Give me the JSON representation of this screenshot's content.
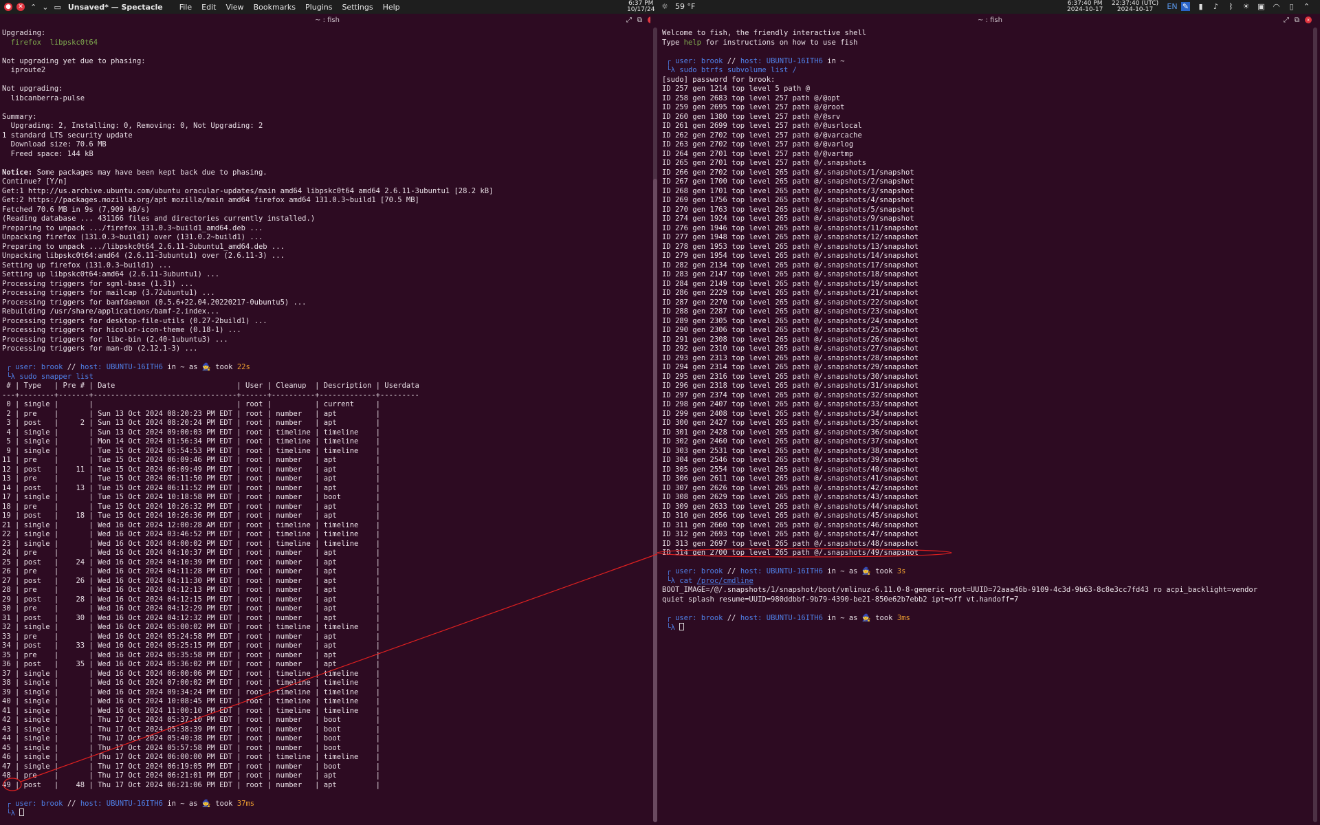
{
  "topbar": {
    "app_title": "Unsaved* — Spectacle",
    "menus": [
      "File",
      "Edit",
      "View",
      "Bookmarks",
      "Plugins",
      "Settings",
      "Help"
    ],
    "clock1_time": "6:37 PM",
    "clock1_date": "10/17/24",
    "weather": "59 °F",
    "clock2_time": "6:37:40 PM",
    "clock2_date": "2024-10-17",
    "clock3_time": "22:37:40 (UTC)",
    "clock3_date": "2024-10-17",
    "lang": "EN"
  },
  "left": {
    "title": "~ : fish",
    "lines": [
      "Upgrading:",
      "  firefox  libpskc0t64",
      "",
      "Not upgrading yet due to phasing:",
      "  iproute2",
      "",
      "Not upgrading:",
      "  libcanberra-pulse",
      "",
      "Summary:",
      "  Upgrading: 2, Installing: 0, Removing: 0, Not Upgrading: 2",
      "1 standard LTS security update",
      "  Download size: 70.6 MB",
      "  Freed space: 144 kB",
      "",
      "Notice: Some packages may have been kept back due to phasing.",
      "Continue? [Y/n]",
      "Get:1 http://us.archive.ubuntu.com/ubuntu oracular-updates/main amd64 libpskc0t64 amd64 2.6.11-3ubuntu1 [28.2 kB]",
      "Get:2 https://packages.mozilla.org/apt mozilla/main amd64 firefox amd64 131.0.3~build1 [70.5 MB]",
      "Fetched 70.6 MB in 9s (7,909 kB/s)",
      "(Reading database ... 431166 files and directories currently installed.)",
      "Preparing to unpack .../firefox_131.0.3~build1_amd64.deb ...",
      "Unpacking firefox (131.0.3~build1) over (131.0.2~build1) ...",
      "Preparing to unpack .../libpskc0t64_2.6.11-3ubuntu1_amd64.deb ...",
      "Unpacking libpskc0t64:amd64 (2.6.11-3ubuntu1) over (2.6.11-3) ...",
      "Setting up firefox (131.0.3~build1) ...",
      "Setting up libpskc0t64:amd64 (2.6.11-3ubuntu1) ...",
      "Processing triggers for sgml-base (1.31) ...",
      "Processing triggers for mailcap (3.72ubuntu1) ...",
      "Processing triggers for bamfdaemon (0.5.6+22.04.20220217-0ubuntu5) ...",
      "Rebuilding /usr/share/applications/bamf-2.index...",
      "Processing triggers for desktop-file-utils (0.27-2build1) ...",
      "Processing triggers for hicolor-icon-theme (0.18-1) ...",
      "Processing triggers for libc-bin (2.40-1ubuntu3) ...",
      "Processing triggers for man-db (2.12.1-3) ...",
      ""
    ],
    "prompt1": {
      "user": "user: brook",
      "sep": " // ",
      "host": "host: UBUNTU-16ITH6",
      "tail": " in ~ as 🧙 took ",
      "took": "22s"
    },
    "cmd1": "sudo snapper list",
    "table_header": " # | Type   | Pre # | Date                            | User | Cleanup  | Description | Userdata",
    "table_rule": "---+--------+-------+---------------------------------+------+----------+-------------+---------",
    "table_rows": [
      " 0 | single |       |                                 | root |          | current     |",
      " 2 | pre    |       | Sun 13 Oct 2024 08:20:23 PM EDT | root | number   | apt         |",
      " 3 | post   |     2 | Sun 13 Oct 2024 08:20:24 PM EDT | root | number   | apt         |",
      " 4 | single |       | Sun 13 Oct 2024 09:00:03 PM EDT | root | timeline | timeline    |",
      " 5 | single |       | Mon 14 Oct 2024 01:56:34 PM EDT | root | timeline | timeline    |",
      " 9 | single |       | Tue 15 Oct 2024 05:54:53 PM EDT | root | timeline | timeline    |",
      "11 | pre    |       | Tue 15 Oct 2024 06:09:46 PM EDT | root | number   | apt         |",
      "12 | post   |    11 | Tue 15 Oct 2024 06:09:49 PM EDT | root | number   | apt         |",
      "13 | pre    |       | Tue 15 Oct 2024 06:11:50 PM EDT | root | number   | apt         |",
      "14 | post   |    13 | Tue 15 Oct 2024 06:11:52 PM EDT | root | number   | apt         |",
      "17 | single |       | Tue 15 Oct 2024 10:18:58 PM EDT | root | number   | boot        |",
      "18 | pre    |       | Tue 15 Oct 2024 10:26:32 PM EDT | root | number   | apt         |",
      "19 | post   |    18 | Tue 15 Oct 2024 10:26:36 PM EDT | root | number   | apt         |",
      "21 | single |       | Wed 16 Oct 2024 12:00:28 AM EDT | root | timeline | timeline    |",
      "22 | single |       | Wed 16 Oct 2024 03:46:52 PM EDT | root | timeline | timeline    |",
      "23 | single |       | Wed 16 Oct 2024 04:00:02 PM EDT | root | timeline | timeline    |",
      "24 | pre    |       | Wed 16 Oct 2024 04:10:37 PM EDT | root | number   | apt         |",
      "25 | post   |    24 | Wed 16 Oct 2024 04:10:39 PM EDT | root | number   | apt         |",
      "26 | pre    |       | Wed 16 Oct 2024 04:11:28 PM EDT | root | number   | apt         |",
      "27 | post   |    26 | Wed 16 Oct 2024 04:11:30 PM EDT | root | number   | apt         |",
      "28 | pre    |       | Wed 16 Oct 2024 04:12:13 PM EDT | root | number   | apt         |",
      "29 | post   |    28 | Wed 16 Oct 2024 04:12:15 PM EDT | root | number   | apt         |",
      "30 | pre    |       | Wed 16 Oct 2024 04:12:29 PM EDT | root | number   | apt         |",
      "31 | post   |    30 | Wed 16 Oct 2024 04:12:32 PM EDT | root | number   | apt         |",
      "32 | single |       | Wed 16 Oct 2024 05:00:02 PM EDT | root | timeline | timeline    |",
      "33 | pre    |       | Wed 16 Oct 2024 05:24:58 PM EDT | root | number   | apt         |",
      "34 | post   |    33 | Wed 16 Oct 2024 05:25:15 PM EDT | root | number   | apt         |",
      "35 | pre    |       | Wed 16 Oct 2024 05:35:58 PM EDT | root | number   | apt         |",
      "36 | post   |    35 | Wed 16 Oct 2024 05:36:02 PM EDT | root | number   | apt         |",
      "37 | single |       | Wed 16 Oct 2024 06:00:06 PM EDT | root | timeline | timeline    |",
      "38 | single |       | Wed 16 Oct 2024 07:00:02 PM EDT | root | timeline | timeline    |",
      "39 | single |       | Wed 16 Oct 2024 09:34:24 PM EDT | root | timeline | timeline    |",
      "40 | single |       | Wed 16 Oct 2024 10:08:45 PM EDT | root | timeline | timeline    |",
      "41 | single |       | Wed 16 Oct 2024 11:00:10 PM EDT | root | timeline | timeline    |",
      "42 | single |       | Thu 17 Oct 2024 05:37:10 PM EDT | root | number   | boot        |",
      "43 | single |       | Thu 17 Oct 2024 05:38:39 PM EDT | root | number   | boot        |",
      "44 | single |       | Thu 17 Oct 2024 05:40:38 PM EDT | root | number   | boot        |",
      "45 | single |       | Thu 17 Oct 2024 05:57:58 PM EDT | root | number   | boot        |",
      "46 | single |       | Thu 17 Oct 2024 06:00:00 PM EDT | root | timeline | timeline    |",
      "47 | single |       | Thu 17 Oct 2024 06:19:05 PM EDT | root | number   | boot        |",
      "48 | pre    |       | Thu 17 Oct 2024 06:21:01 PM EDT | root | number   | apt         |",
      "49 | post   |    48 | Thu 17 Oct 2024 06:21:06 PM EDT | root | number   | apt         |"
    ],
    "prompt2": {
      "user": "user: brook",
      "sep": " // ",
      "host": "host: UBUNTU-16ITH6",
      "tail": " in ~ as 🧙 took ",
      "took": "37ms"
    }
  },
  "right": {
    "title": "~ : fish",
    "welcome1": "Welcome to fish, the friendly interactive shell",
    "welcome2_a": "Type ",
    "welcome2_help": "help",
    "welcome2_b": " for instructions on how to use fish",
    "prompt1": {
      "user": "user: brook",
      "sep": " // ",
      "host": "host: UBUNTU-16ITH6",
      "tail": " in ~"
    },
    "cmd1": "sudo btrfs subvolume list /",
    "sudo_line": "[sudo] password for brook:",
    "subvol_lines": [
      "ID 257 gen 1214 top level 5 path @",
      "ID 258 gen 2683 top level 257 path @/@opt",
      "ID 259 gen 2695 top level 257 path @/@root",
      "ID 260 gen 1380 top level 257 path @/@srv",
      "ID 261 gen 2699 top level 257 path @/@usrlocal",
      "ID 262 gen 2702 top level 257 path @/@varcache",
      "ID 263 gen 2702 top level 257 path @/@varlog",
      "ID 264 gen 2701 top level 257 path @/@vartmp",
      "ID 265 gen 2701 top level 257 path @/.snapshots",
      "ID 266 gen 2702 top level 265 path @/.snapshots/1/snapshot",
      "ID 267 gen 1700 top level 265 path @/.snapshots/2/snapshot",
      "ID 268 gen 1701 top level 265 path @/.snapshots/3/snapshot",
      "ID 269 gen 1756 top level 265 path @/.snapshots/4/snapshot",
      "ID 270 gen 1763 top level 265 path @/.snapshots/5/snapshot",
      "ID 274 gen 1924 top level 265 path @/.snapshots/9/snapshot",
      "ID 276 gen 1946 top level 265 path @/.snapshots/11/snapshot",
      "ID 277 gen 1948 top level 265 path @/.snapshots/12/snapshot",
      "ID 278 gen 1953 top level 265 path @/.snapshots/13/snapshot",
      "ID 279 gen 1954 top level 265 path @/.snapshots/14/snapshot",
      "ID 282 gen 2134 top level 265 path @/.snapshots/17/snapshot",
      "ID 283 gen 2147 top level 265 path @/.snapshots/18/snapshot",
      "ID 284 gen 2149 top level 265 path @/.snapshots/19/snapshot",
      "ID 286 gen 2229 top level 265 path @/.snapshots/21/snapshot",
      "ID 287 gen 2270 top level 265 path @/.snapshots/22/snapshot",
      "ID 288 gen 2287 top level 265 path @/.snapshots/23/snapshot",
      "ID 289 gen 2305 top level 265 path @/.snapshots/24/snapshot",
      "ID 290 gen 2306 top level 265 path @/.snapshots/25/snapshot",
      "ID 291 gen 2308 top level 265 path @/.snapshots/26/snapshot",
      "ID 292 gen 2310 top level 265 path @/.snapshots/27/snapshot",
      "ID 293 gen 2313 top level 265 path @/.snapshots/28/snapshot",
      "ID 294 gen 2314 top level 265 path @/.snapshots/29/snapshot",
      "ID 295 gen 2316 top level 265 path @/.snapshots/30/snapshot",
      "ID 296 gen 2318 top level 265 path @/.snapshots/31/snapshot",
      "ID 297 gen 2374 top level 265 path @/.snapshots/32/snapshot",
      "ID 298 gen 2407 top level 265 path @/.snapshots/33/snapshot",
      "ID 299 gen 2408 top level 265 path @/.snapshots/34/snapshot",
      "ID 300 gen 2427 top level 265 path @/.snapshots/35/snapshot",
      "ID 301 gen 2428 top level 265 path @/.snapshots/36/snapshot",
      "ID 302 gen 2460 top level 265 path @/.snapshots/37/snapshot",
      "ID 303 gen 2531 top level 265 path @/.snapshots/38/snapshot",
      "ID 304 gen 2546 top level 265 path @/.snapshots/39/snapshot",
      "ID 305 gen 2554 top level 265 path @/.snapshots/40/snapshot",
      "ID 306 gen 2611 top level 265 path @/.snapshots/41/snapshot",
      "ID 307 gen 2626 top level 265 path @/.snapshots/42/snapshot",
      "ID 308 gen 2629 top level 265 path @/.snapshots/43/snapshot",
      "ID 309 gen 2633 top level 265 path @/.snapshots/44/snapshot",
      "ID 310 gen 2656 top level 265 path @/.snapshots/45/snapshot",
      "ID 311 gen 2660 top level 265 path @/.snapshots/46/snapshot",
      "ID 312 gen 2693 top level 265 path @/.snapshots/47/snapshot",
      "ID 313 gen 2697 top level 265 path @/.snapshots/48/snapshot",
      "ID 314 gen 2700 top level 265 path @/.snapshots/49/snapshot"
    ],
    "prompt2": {
      "user": "user: brook",
      "sep": " // ",
      "host": "host: UBUNTU-16ITH6",
      "tail": " in ~ as 🧙 took ",
      "took": "3s"
    },
    "cmd2_a": "cat ",
    "cmd2_b": "/proc/cmdline",
    "cmdline1": "BOOT_IMAGE=/@/.snapshots/1/snapshot/boot/vmlinuz-6.11.0-8-generic root=UUID=72aaa46b-9109-4c3d-9b63-8c8e3cc7fd43 ro acpi_backlight=vendor",
    "cmdline2": "quiet splash resume=UUID=980ddbbf-9b79-4390-be21-850e62b7ebb2 ipt=off vt.handoff=7",
    "prompt3": {
      "user": "user: brook",
      "sep": " // ",
      "host": "host: UBUNTU-16ITH6",
      "tail": " in ~ as 🧙 took ",
      "took": "3ms"
    }
  },
  "colors": {
    "background": "#2d0b22",
    "prompt_blue": "#4f80e8",
    "took_orange": "#f0a030",
    "package_green": "#7ea84e",
    "annotation_red": "#e02020"
  }
}
